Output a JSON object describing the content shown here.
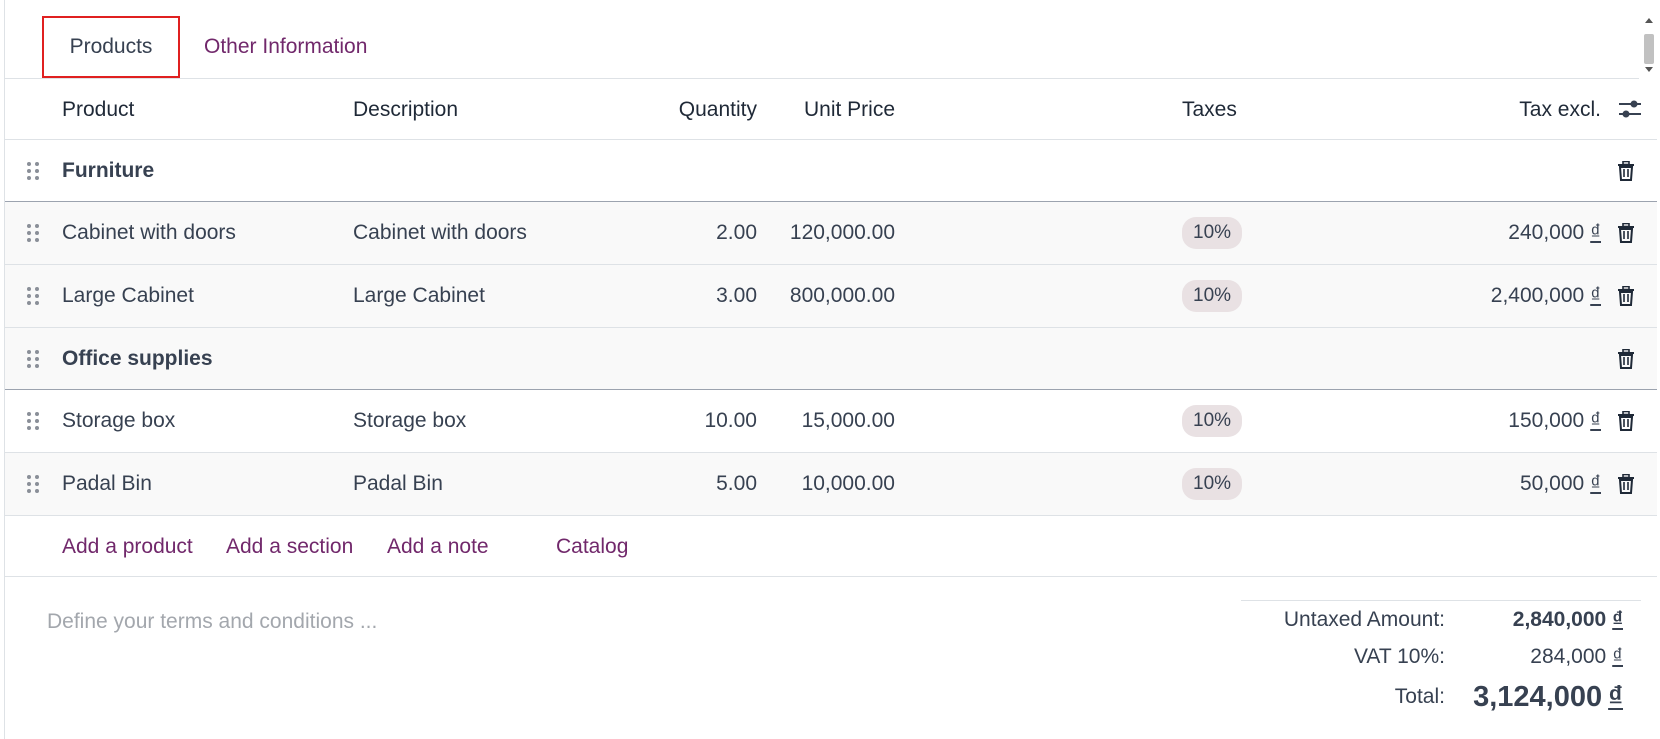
{
  "tabs": [
    {
      "label": "Products"
    },
    {
      "label": "Other Information"
    }
  ],
  "columns": {
    "product": "Product",
    "description": "Description",
    "quantity": "Quantity",
    "unit_price": "Unit Price",
    "taxes": "Taxes",
    "tax_excl": "Tax excl."
  },
  "sections": [
    {
      "name": "Furniture",
      "lines": [
        {
          "product": "Cabinet with doors",
          "description": "Cabinet with doors",
          "quantity": "2.00",
          "unit_price": "120,000.00",
          "tax": "10%",
          "subtotal": "240,000"
        },
        {
          "product": "Large Cabinet",
          "description": "Large Cabinet",
          "quantity": "3.00",
          "unit_price": "800,000.00",
          "tax": "10%",
          "subtotal": "2,400,000"
        }
      ]
    },
    {
      "name": "Office supplies",
      "lines": [
        {
          "product": "Storage box",
          "description": "Storage box",
          "quantity": "10.00",
          "unit_price": "15,000.00",
          "tax": "10%",
          "subtotal": "150,000"
        },
        {
          "product": "Padal Bin",
          "description": "Padal Bin",
          "quantity": "5.00",
          "unit_price": "10,000.00",
          "tax": "10%",
          "subtotal": "50,000"
        }
      ]
    }
  ],
  "currency_symbol": "₫",
  "actions": {
    "add_product": "Add a product",
    "add_section": "Add a section",
    "add_note": "Add a note",
    "catalog": "Catalog"
  },
  "terms": {
    "placeholder": "Define your terms and conditions ..."
  },
  "totals": {
    "untaxed_label": "Untaxed Amount:",
    "untaxed_value": "2,840,000",
    "vat_label": "VAT 10%:",
    "vat_value": "284,000",
    "total_label": "Total:",
    "total_value": "3,124,000"
  },
  "colors": {
    "link": "#71286b",
    "tab_highlight": "#e02020",
    "badge_bg": "#e9e1e3"
  },
  "icons": {
    "drag": "drag-handle-icon",
    "delete": "trash-icon",
    "settings": "column-settings-icon"
  }
}
